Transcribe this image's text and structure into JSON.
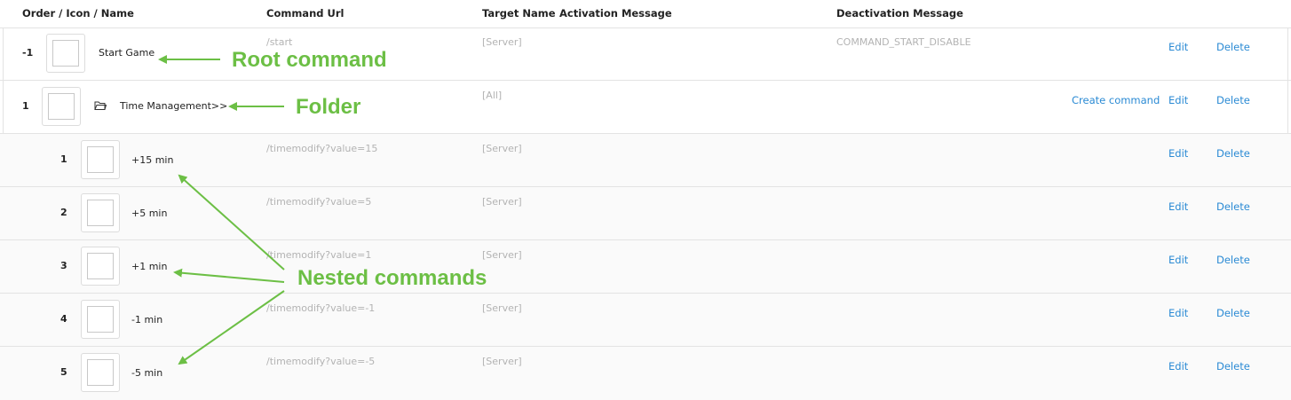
{
  "table": {
    "headers": {
      "order_icon_name": "Order / Icon / Name",
      "command_url": "Command Url",
      "target_name": "Target Name",
      "activation_message": "Activation Message",
      "deactivation_message": "Deactivation Message"
    },
    "rows": [
      {
        "order": "-1",
        "name": "Start Game",
        "url": "/start",
        "target": "[Server]",
        "deactivation": "COMMAND_START_DISABLE",
        "edit": "Edit",
        "delete": "Delete"
      },
      {
        "order": "1",
        "name": "Time Management>>",
        "url": "",
        "target": "[All]",
        "deactivation": "",
        "create": "Create command",
        "edit": "Edit",
        "delete": "Delete",
        "icon": "folder-icon"
      },
      {
        "order": "1",
        "name": "+15 min",
        "url": "/timemodify?value=15",
        "target": "[Server]",
        "edit": "Edit",
        "delete": "Delete"
      },
      {
        "order": "2",
        "name": "+5 min",
        "url": "/timemodify?value=5",
        "target": "[Server]",
        "edit": "Edit",
        "delete": "Delete"
      },
      {
        "order": "3",
        "name": "+1 min",
        "url": "/timemodify?value=1",
        "target": "[Server]",
        "edit": "Edit",
        "delete": "Delete"
      },
      {
        "order": "4",
        "name": "-1 min",
        "url": "/timemodify?value=-1",
        "target": "[Server]",
        "edit": "Edit",
        "delete": "Delete"
      },
      {
        "order": "5",
        "name": "-5 min",
        "url": "/timemodify?value=-5",
        "target": "[Server]",
        "edit": "Edit",
        "delete": "Delete"
      }
    ]
  },
  "annotations": {
    "root": "Root command",
    "folder": "Folder",
    "nested": "Nested commands"
  },
  "colors": {
    "annotation": "#6cbf45",
    "link": "#2a8ad4",
    "muted_text": "#b3b3b3",
    "border": "#e3e3e3"
  }
}
